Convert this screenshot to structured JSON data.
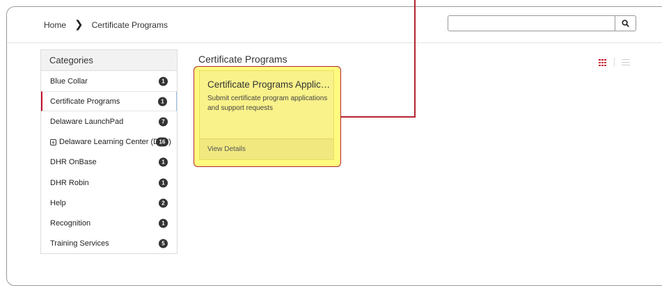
{
  "breadcrumb": {
    "home": "Home",
    "current": "Certificate Programs"
  },
  "search": {
    "value": "",
    "placeholder": ""
  },
  "categories": {
    "header": "Categories",
    "items": [
      {
        "label": "Blue Collar",
        "count": "1"
      },
      {
        "label": "Certificate Programs",
        "count": "1",
        "active": true
      },
      {
        "label": "Delaware LaunchPad",
        "count": "7"
      },
      {
        "label": "Delaware Learning Center (DLC)",
        "count": "16",
        "expandable": true
      },
      {
        "label": "DHR OnBase",
        "count": "1"
      },
      {
        "label": "DHR Robin",
        "count": "1"
      },
      {
        "label": "Help",
        "count": "2"
      },
      {
        "label": "Recognition",
        "count": "1"
      },
      {
        "label": "Training Services",
        "count": "5"
      }
    ]
  },
  "main": {
    "section_title": "Certificate Programs",
    "card": {
      "title": "Certificate Programs Applic…",
      "description": "Submit certificate program applications and support requests",
      "footer": "View Details"
    }
  },
  "icons": {
    "breadcrumb_separator": "chevron-right-icon",
    "search": "search-icon",
    "grid_view": "grid-view-icon",
    "list_view": "list-view-icon",
    "expand": "plus-square-icon"
  },
  "colors": {
    "accent": "#c8102e",
    "badge": "#333333",
    "highlight": "#f9f28a",
    "annotation": "#b3242e"
  }
}
